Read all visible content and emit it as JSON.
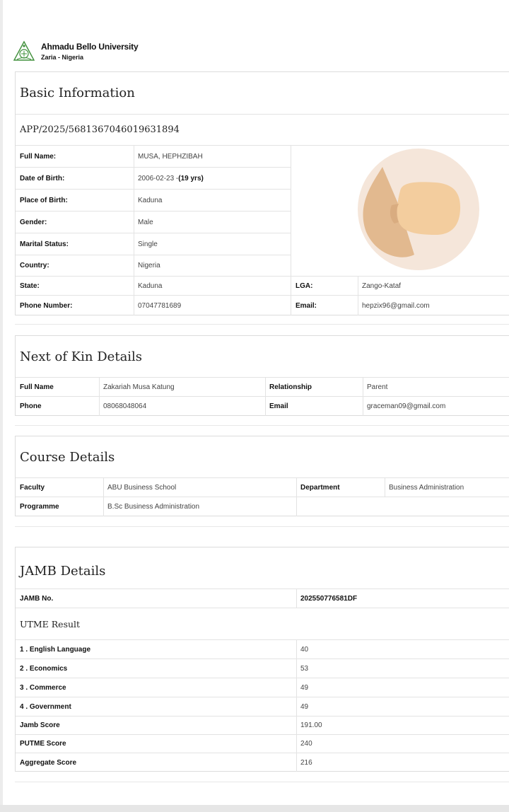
{
  "header": {
    "university": "Ahmadu Bello University",
    "location": "Zaria - Nigeria"
  },
  "basic": {
    "title": "Basic Information",
    "app_no": "APP/2025/5681367046019631894",
    "full_name": {
      "label": "Full Name:",
      "value": "MUSA, HEPHZIBAH"
    },
    "dob": {
      "label": "Date of Birth:",
      "value": "2006-02-23 - ",
      "age": "(19 yrs)"
    },
    "pob": {
      "label": "Place of Birth:",
      "value": "Kaduna"
    },
    "gender": {
      "label": "Gender:",
      "value": "Male"
    },
    "marital": {
      "label": "Marital Status:",
      "value": "Single"
    },
    "country": {
      "label": "Country:",
      "value": "Nigeria"
    },
    "state": {
      "label": "State:",
      "value": "Kaduna"
    },
    "lga": {
      "label": "LGA:",
      "value": "Zango-Kataf"
    },
    "phone": {
      "label": "Phone Number:",
      "value": "07047781689"
    },
    "email": {
      "label": "Email:",
      "value": "hepzix96@gmail.com"
    }
  },
  "kin": {
    "title": "Next of Kin Details",
    "full_name": {
      "label": "Full Name",
      "value": "Zakariah Musa Katung"
    },
    "relationship": {
      "label": "Relationship",
      "value": "Parent"
    },
    "phone": {
      "label": "Phone",
      "value": "08068048064"
    },
    "email": {
      "label": "Email",
      "value": "graceman09@gmail.com"
    }
  },
  "course": {
    "title": "Course Details",
    "faculty": {
      "label": "Faculty",
      "value": "ABU Business School"
    },
    "department": {
      "label": "Department",
      "value": "Business Administration"
    },
    "programme": {
      "label": "Programme",
      "value": "B.Sc Business Administration"
    }
  },
  "jamb": {
    "title": "JAMB Details",
    "jamb_no": {
      "label": "JAMB No.",
      "value": "202550776581DF"
    },
    "utme_title": "UTME Result",
    "subjects": [
      {
        "label": "1 . English Language",
        "value": "40"
      },
      {
        "label": "2 . Economics",
        "value": "53"
      },
      {
        "label": "3 . Commerce",
        "value": "49"
      },
      {
        "label": "4 . Government",
        "value": "49"
      }
    ],
    "jamb_score": {
      "label": "Jamb Score",
      "value": "191.00"
    },
    "putme_score": {
      "label": "PUTME Score",
      "value": "240"
    },
    "aggregate_score": {
      "label": "Aggregate Score",
      "value": "216"
    }
  },
  "colors": {
    "logo_green": "#3f8f3a",
    "avatar_bg": "#f5e6da",
    "avatar_skin": "#f3cd9e",
    "avatar_hair": "#e2b98f"
  },
  "icons": {
    "logo": "university-crest-icon",
    "photo": "profile-placeholder-icon"
  }
}
